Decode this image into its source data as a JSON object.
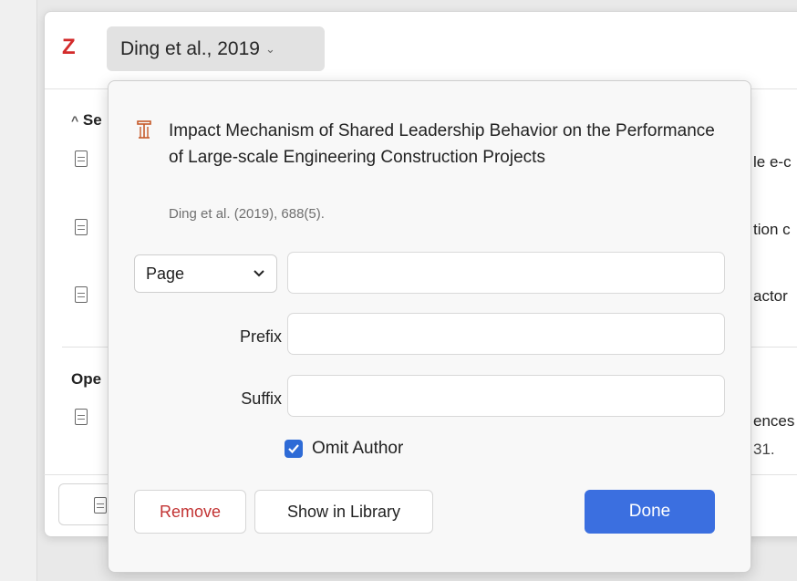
{
  "background": {
    "section_header": "Se",
    "open_header": "Ope",
    "items": [
      {
        "right_text": "le e-c"
      },
      {
        "right_text": "tion c"
      },
      {
        "right_text": "actor"
      },
      {
        "right_text": "ences",
        "right_subtext": "31."
      }
    ]
  },
  "header": {
    "logo": "Z",
    "citation_label": "Ding et al., 2019",
    "chevron": "⌄"
  },
  "popup": {
    "item_icon": "book-icon",
    "title": "Impact Mechanism of Shared Leadership Behavior on the Performance of Large-scale Engineering Construction Projects",
    "meta": "Ding et al. (2019), 688(5).",
    "locator": {
      "selected": "Page",
      "value": ""
    },
    "prefix": {
      "label": "Prefix",
      "value": ""
    },
    "suffix": {
      "label": "Suffix",
      "value": ""
    },
    "omit_author": {
      "label": "Omit Author",
      "checked": true
    },
    "buttons": {
      "remove": "Remove",
      "show_in_library": "Show in Library",
      "done": "Done"
    }
  },
  "colors": {
    "accent": "#3b6fe0",
    "danger": "#c23333",
    "logo": "#d32b2b"
  }
}
